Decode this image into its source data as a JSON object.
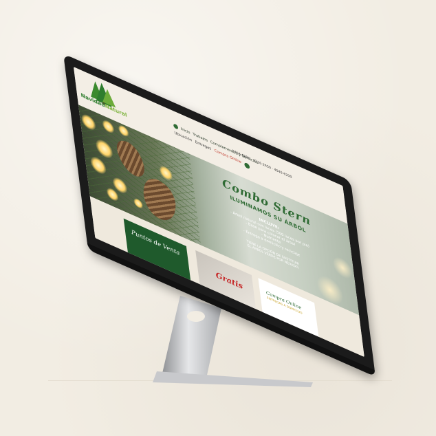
{
  "brand": {
    "name_dark": "Navidad",
    "name_light": "Natural"
  },
  "topbar": {
    "links": [
      "Inicio",
      "Trabajos",
      "Complementos y Servicios"
    ],
    "phones": "2758-0800 · 3216-2450 · 4040-6200"
  },
  "nav": {
    "items": [
      "Ubicación",
      "Entregas"
    ],
    "cta": "Compra Online"
  },
  "hero": {
    "title": "Combo Stern",
    "subtitle": "ILUMINAMOS SU ÁRBOL",
    "includes": "INCLUYE:",
    "list": [
      "- Árbol natural con luces (100 luces por pie)",
      "- Base para colocar el árbol",
      "- Nutriente",
      "- Entrega a domicilio y reciclaje"
    ],
    "note_line1": "TIENE LA OPCIÓN DE SUSTITUIR",
    "note_line2": "EL ÁRBOL VERDE POR NEVADO."
  },
  "cards": {
    "points": "Puntos de Venta",
    "free": "Gratis",
    "online": "Compra Online",
    "online_sub": "ENTREGAS A DOMICILIO"
  },
  "colors": {
    "brand_green": "#2f6b34",
    "accent_red": "#c62828",
    "bezel": "#1b1b1b",
    "backdrop": "#f2ede3"
  }
}
